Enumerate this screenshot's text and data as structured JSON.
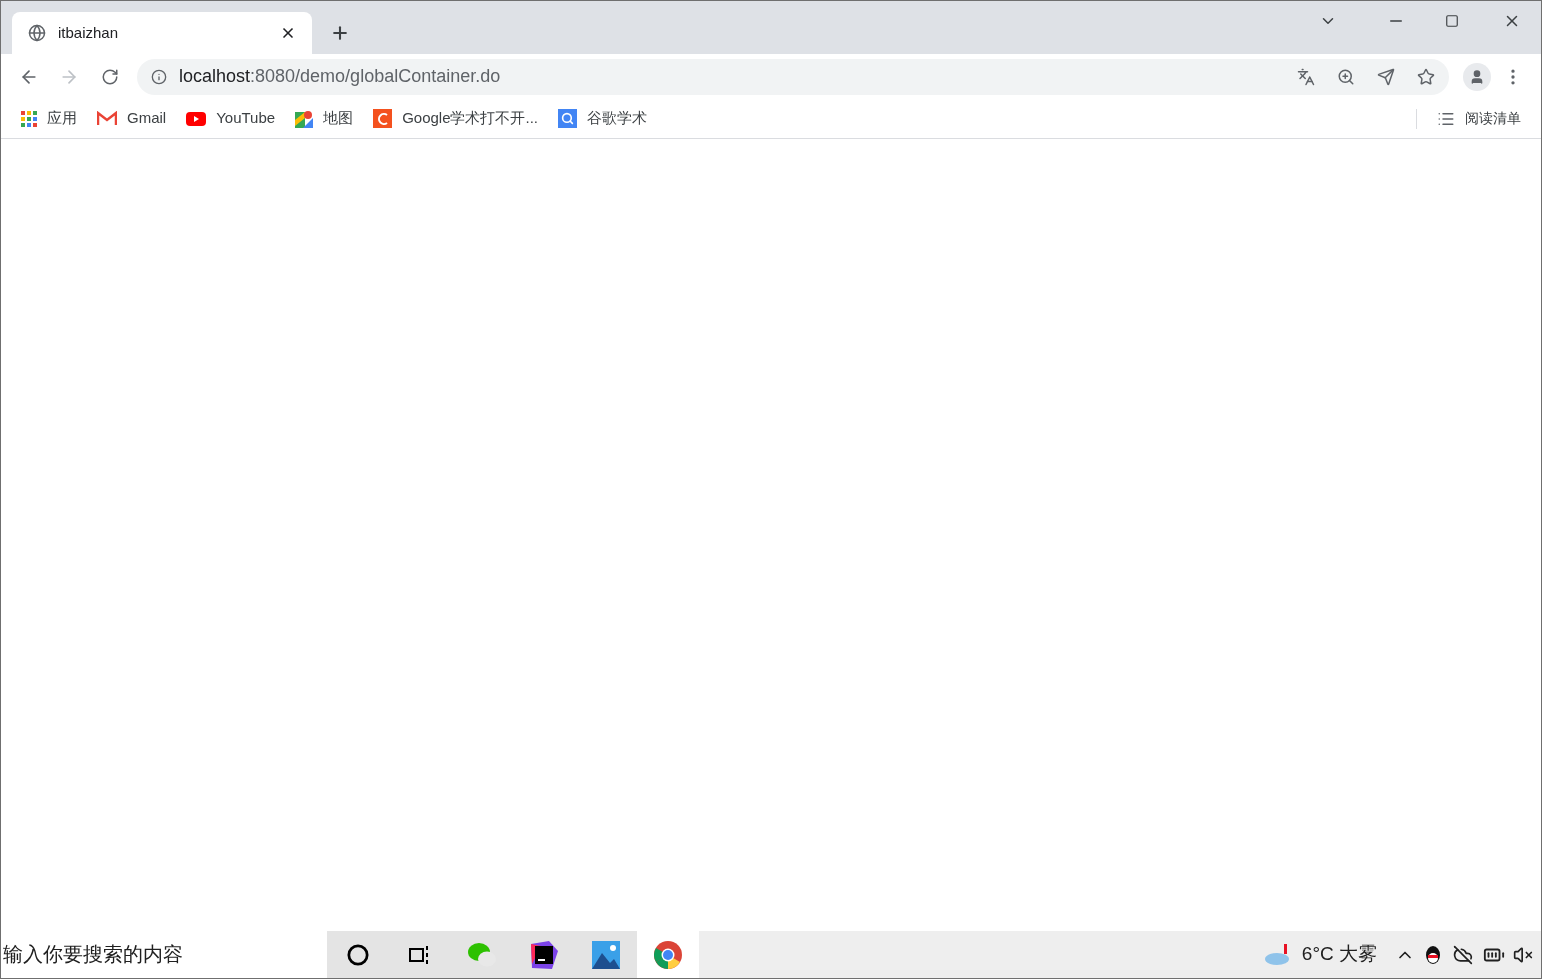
{
  "tab": {
    "title": "itbaizhan",
    "selected": true
  },
  "address": {
    "host": "localhost",
    "path": ":8080/demo/globalContainer.do"
  },
  "bookmarks": [
    {
      "kind": "apps",
      "label": "应用"
    },
    {
      "kind": "gmail",
      "label": "Gmail"
    },
    {
      "kind": "youtube",
      "label": "YouTube"
    },
    {
      "kind": "maps",
      "label": "地图"
    },
    {
      "kind": "c",
      "label": "Google学术打不开..."
    },
    {
      "kind": "search",
      "label": "谷歌学术"
    }
  ],
  "reading_list": "阅读清单",
  "taskbar": {
    "search_placeholder": "输入你要搜索的内容",
    "apps": [
      {
        "kind": "cortana",
        "selected": false
      },
      {
        "kind": "taskview",
        "selected": false
      },
      {
        "kind": "wechat",
        "selected": false
      },
      {
        "kind": "idea",
        "selected": false
      },
      {
        "kind": "photos",
        "selected": false
      },
      {
        "kind": "chrome",
        "selected": true
      }
    ],
    "weather": "6°C 大雾"
  }
}
